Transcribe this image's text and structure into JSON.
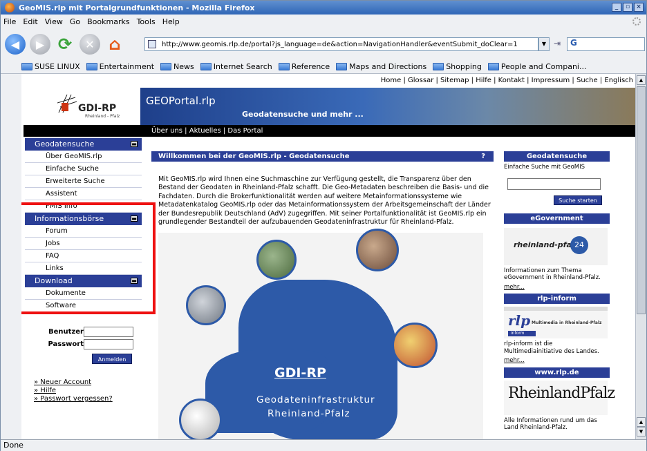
{
  "window": {
    "title": "GeoMIS.rlp mit Portalgrundfunktionen - Mozilla Firefox"
  },
  "menu": [
    "File",
    "Edit",
    "View",
    "Go",
    "Bookmarks",
    "Tools",
    "Help"
  ],
  "url": "http://www.geomis.rlp.de/portal?js_language=de&action=NavigationHandler&eventSubmit_doClear=1",
  "search_engine_glyph": "G",
  "bookmarks": [
    "SUSE LINUX",
    "Entertainment",
    "News",
    "Internet Search",
    "Reference",
    "Maps and Directions",
    "Shopping",
    "People and Compani..."
  ],
  "status": "Done",
  "page": {
    "toplinks": "Home  |  Glossar  |  Sitemap  |  Hilfe  |  Kontakt  |  Impressum  |  Suche  |  Englisch",
    "logo_text": "GDI-RP",
    "logo_sub": "Rheinland - Pfalz",
    "banner_title": "GEOPortal.rlp",
    "banner_sub": "Geodatensuche und mehr ...",
    "subnav": "Über uns  |  Aktuelles  |  Das Portal",
    "nav": [
      {
        "title": "Geodatensuche",
        "items": [
          "Über GeoMIS.rlp",
          "Einfache Suche",
          "Erweiterte Suche",
          "Assistent",
          "FMIS Info"
        ]
      },
      {
        "title": "Informationsbörse",
        "items": [
          "Forum",
          "Jobs",
          "FAQ",
          "Links"
        ]
      },
      {
        "title": "Download",
        "items": [
          "Dokumente",
          "Software"
        ]
      }
    ],
    "login": {
      "user_label": "Benutzer",
      "pass_label": "Passwort",
      "button": "Anmelden"
    },
    "links": [
      "» Neuer Account",
      "» Hilfe",
      "» Passwort vergessen?"
    ],
    "main_heading": "Willkommen bei der GeoMIS.rlp - Geodatensuche",
    "main_help": "?",
    "main_text": "Mit GeoMIS.rlp wird Ihnen eine Suchmaschine zur Verfügung gestellt, die Transparenz über den Bestand der Geodaten in Rheinland-Pfalz schafft. Die Geo-Metadaten beschreiben die Basis- und die Fachdaten. Durch die Brokerfunktionalität werden auf weitere Metainformationssysteme wie Metadatenkatalog GeoMIS.rlp oder das Metainformationssystem der Arbeitsgemeinschaft der Länder der Bundesrepublik Deutschland (AdV) zugegriffen. Mit seiner Portalfunktionalität ist GeoMIS.rlp ein grundlegender Bestandteil der aufzubauenden Geodateninfrastruktur für Rheinland-Pfalz.",
    "map_title": "GDI-RP",
    "map_sub1": "Geodateninfrastruktur",
    "map_sub2": "Rheinland-Pfalz",
    "right": {
      "search_head": "Geodatensuche",
      "search_text": "Einfache Suche mit GeoMIS",
      "search_button": "Suche starten",
      "egov_head": "eGovernment",
      "egov_logo": "rheinland-pfalz",
      "egov_badge": "24",
      "egov_text": "Informationen zum Thema eGovernment in Rheinland-Pfalz.",
      "more": "mehr...",
      "inform_head": "rlp-inform",
      "inform_logo": "rlp",
      "inform_tag": "Multimedia in Rheinland-Pfalz",
      "inform_badge": "inform",
      "inform_text": "rlp-inform ist die Multimediainitiative des Landes.",
      "www_head": "www.rlp.de",
      "www_logo": "RheinlandPfalz",
      "www_text": "Alle Informationen rund um das Land Rheinland-Pfalz."
    }
  }
}
